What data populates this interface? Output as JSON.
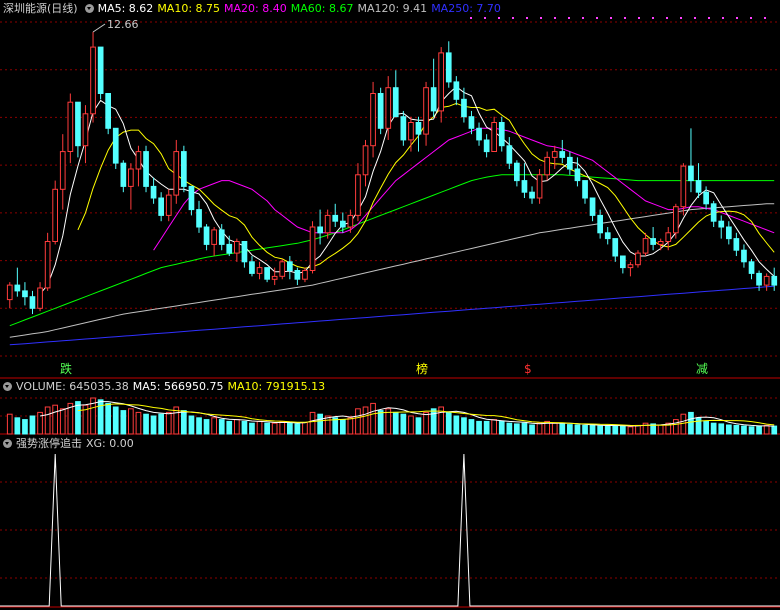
{
  "main_legend": {
    "title": "深圳能源(日线)",
    "ma5": "MA5: 8.62",
    "ma10": "MA10: 8.75",
    "ma20": "MA20: 8.40",
    "ma60": "MA60: 8.67",
    "ma120": "MA120: 9.41",
    "ma250": "MA250: 7.70"
  },
  "volume_legend": {
    "volume": "VOLUME: 645035.38",
    "ma5": "MA5: 566950.75",
    "ma10": "MA10: 791915.13"
  },
  "indicator_legend": {
    "name": "强势涨停追击",
    "xg": "XG: 0.00"
  },
  "high_label": "12.66",
  "markers": {
    "m1": "跌",
    "m2": "榜",
    "m3": "$",
    "m4": "减"
  },
  "colors": {
    "up": "#ff3c3c",
    "down": "#54ffff",
    "ma5": "#ffffff",
    "ma10": "#ffff00",
    "ma20": "#ff00ff",
    "ma60": "#00ff00",
    "ma120": "#c0c0c0",
    "ma250": "#3030ff",
    "grid": "#8b0000",
    "axis": "#c00000"
  },
  "chart_data": {
    "type": "candlestick",
    "price_range": [
      7.25,
      12.66
    ],
    "candles": [
      [
        8.05,
        8.35,
        7.9,
        8.3
      ],
      [
        8.3,
        8.6,
        8.1,
        8.2
      ],
      [
        8.2,
        8.35,
        7.95,
        8.1
      ],
      [
        8.1,
        8.2,
        7.8,
        7.9
      ],
      [
        7.9,
        8.35,
        7.85,
        8.25
      ],
      [
        8.25,
        9.2,
        8.2,
        9.05
      ],
      [
        9.05,
        10.1,
        9.0,
        9.95
      ],
      [
        9.95,
        10.9,
        9.6,
        10.6
      ],
      [
        10.6,
        11.6,
        10.4,
        11.45
      ],
      [
        11.45,
        11.4,
        10.5,
        10.7
      ],
      [
        10.7,
        11.4,
        10.4,
        11.25
      ],
      [
        11.25,
        12.66,
        11.1,
        12.4
      ],
      [
        12.4,
        12.2,
        11.5,
        11.6
      ],
      [
        11.6,
        11.4,
        10.9,
        11.0
      ],
      [
        11.0,
        10.95,
        10.3,
        10.4
      ],
      [
        10.4,
        10.45,
        9.9,
        10.0
      ],
      [
        10.0,
        10.4,
        9.6,
        10.3
      ],
      [
        10.3,
        10.7,
        10.0,
        10.6
      ],
      [
        10.6,
        10.7,
        9.9,
        10.0
      ],
      [
        10.0,
        10.15,
        9.7,
        9.8
      ],
      [
        9.8,
        9.9,
        9.4,
        9.5
      ],
      [
        9.5,
        9.95,
        9.4,
        9.85
      ],
      [
        9.85,
        10.8,
        9.7,
        10.6
      ],
      [
        10.6,
        10.7,
        9.9,
        10.0
      ],
      [
        10.0,
        9.95,
        9.5,
        9.6
      ],
      [
        9.6,
        9.75,
        9.2,
        9.3
      ],
      [
        9.3,
        9.35,
        8.9,
        9.0
      ],
      [
        9.0,
        9.3,
        8.8,
        9.25
      ],
      [
        9.25,
        9.35,
        8.9,
        9.0
      ],
      [
        9.0,
        9.15,
        8.8,
        8.85
      ],
      [
        8.85,
        9.1,
        8.7,
        9.05
      ],
      [
        9.05,
        9.0,
        8.6,
        8.7
      ],
      [
        8.7,
        8.8,
        8.45,
        8.5
      ],
      [
        8.5,
        8.7,
        8.4,
        8.6
      ],
      [
        8.6,
        8.55,
        8.35,
        8.4
      ],
      [
        8.4,
        8.6,
        8.3,
        8.45
      ],
      [
        8.45,
        8.75,
        8.4,
        8.7
      ],
      [
        8.7,
        8.8,
        8.4,
        8.55
      ],
      [
        8.55,
        8.6,
        8.3,
        8.4
      ],
      [
        8.4,
        8.6,
        8.35,
        8.55
      ],
      [
        8.55,
        9.4,
        8.5,
        9.3
      ],
      [
        9.3,
        9.6,
        9.0,
        9.2
      ],
      [
        9.2,
        9.6,
        9.1,
        9.5
      ],
      [
        9.5,
        9.7,
        9.3,
        9.4
      ],
      [
        9.4,
        9.55,
        9.2,
        9.3
      ],
      [
        9.3,
        9.6,
        9.2,
        9.5
      ],
      [
        9.5,
        10.4,
        9.4,
        10.2
      ],
      [
        10.2,
        10.8,
        10.0,
        10.7
      ],
      [
        10.7,
        11.8,
        10.5,
        11.6
      ],
      [
        11.6,
        11.7,
        10.9,
        11.0
      ],
      [
        11.0,
        11.9,
        10.8,
        11.7
      ],
      [
        11.7,
        12.0,
        11.5,
        11.2
      ],
      [
        11.2,
        11.3,
        10.7,
        10.8
      ],
      [
        10.8,
        11.2,
        10.6,
        11.1
      ],
      [
        11.1,
        11.2,
        10.6,
        10.9
      ],
      [
        10.9,
        11.8,
        10.7,
        11.7
      ],
      [
        11.7,
        12.2,
        11.2,
        11.3
      ],
      [
        11.3,
        12.4,
        11.1,
        12.3
      ],
      [
        12.3,
        12.5,
        11.7,
        11.8
      ],
      [
        11.8,
        11.9,
        11.4,
        11.5
      ],
      [
        11.5,
        11.7,
        11.1,
        11.2
      ],
      [
        11.2,
        11.3,
        10.9,
        11.0
      ],
      [
        11.0,
        11.1,
        10.7,
        10.8
      ],
      [
        10.8,
        10.9,
        10.5,
        10.6
      ],
      [
        10.6,
        11.2,
        10.6,
        11.1
      ],
      [
        11.1,
        11.2,
        10.6,
        10.7
      ],
      [
        10.7,
        10.85,
        10.3,
        10.4
      ],
      [
        10.4,
        10.45,
        10.0,
        10.1
      ],
      [
        10.1,
        10.4,
        9.8,
        9.9
      ],
      [
        9.9,
        10.0,
        9.7,
        9.8
      ],
      [
        9.8,
        10.3,
        9.7,
        10.2
      ],
      [
        10.2,
        10.6,
        10.1,
        10.5
      ],
      [
        10.5,
        10.7,
        10.3,
        10.6
      ],
      [
        10.6,
        10.8,
        10.4,
        10.5
      ],
      [
        10.5,
        10.6,
        10.2,
        10.3
      ],
      [
        10.3,
        10.5,
        10.0,
        10.1
      ],
      [
        10.1,
        10.1,
        9.7,
        9.8
      ],
      [
        9.8,
        9.8,
        9.4,
        9.5
      ],
      [
        9.5,
        9.6,
        9.1,
        9.2
      ],
      [
        9.2,
        9.3,
        9.0,
        9.1
      ],
      [
        9.1,
        9.1,
        8.7,
        8.8
      ],
      [
        8.8,
        8.8,
        8.5,
        8.6
      ],
      [
        8.6,
        8.7,
        8.45,
        8.65
      ],
      [
        8.65,
        8.9,
        8.6,
        8.85
      ],
      [
        8.85,
        9.2,
        8.8,
        9.1
      ],
      [
        9.1,
        9.3,
        8.9,
        9.0
      ],
      [
        9.0,
        9.1,
        8.9,
        9.05
      ],
      [
        9.05,
        9.3,
        8.9,
        9.2
      ],
      [
        9.2,
        9.7,
        9.1,
        9.65
      ],
      [
        9.65,
        10.4,
        9.5,
        10.35
      ],
      [
        10.35,
        11.0,
        9.9,
        10.1
      ],
      [
        10.1,
        10.4,
        9.8,
        9.9
      ],
      [
        9.9,
        10.0,
        9.6,
        9.7
      ],
      [
        9.7,
        9.75,
        9.3,
        9.4
      ],
      [
        9.4,
        9.5,
        9.1,
        9.3
      ],
      [
        9.3,
        9.4,
        9.0,
        9.1
      ],
      [
        9.1,
        9.2,
        8.8,
        8.9
      ],
      [
        8.9,
        9.0,
        8.6,
        8.7
      ],
      [
        8.7,
        8.75,
        8.4,
        8.5
      ],
      [
        8.5,
        8.55,
        8.2,
        8.3
      ],
      [
        8.3,
        8.5,
        8.2,
        8.45
      ],
      [
        8.45,
        8.6,
        8.2,
        8.3
      ]
    ],
    "volume_ratio": [
      0.55,
      0.45,
      0.4,
      0.5,
      0.6,
      0.75,
      0.8,
      0.7,
      0.85,
      0.9,
      0.8,
      1.0,
      0.95,
      0.85,
      0.75,
      0.65,
      0.7,
      0.6,
      0.55,
      0.5,
      0.55,
      0.6,
      0.75,
      0.65,
      0.5,
      0.45,
      0.4,
      0.45,
      0.4,
      0.35,
      0.4,
      0.35,
      0.3,
      0.35,
      0.3,
      0.3,
      0.35,
      0.3,
      0.28,
      0.32,
      0.6,
      0.55,
      0.5,
      0.45,
      0.4,
      0.45,
      0.7,
      0.75,
      0.85,
      0.65,
      0.7,
      0.6,
      0.55,
      0.5,
      0.45,
      0.6,
      0.7,
      0.75,
      0.6,
      0.5,
      0.45,
      0.4,
      0.35,
      0.35,
      0.4,
      0.35,
      0.3,
      0.28,
      0.3,
      0.25,
      0.3,
      0.35,
      0.3,
      0.28,
      0.26,
      0.25,
      0.24,
      0.25,
      0.22,
      0.22,
      0.25,
      0.22,
      0.2,
      0.24,
      0.3,
      0.28,
      0.25,
      0.3,
      0.4,
      0.55,
      0.6,
      0.45,
      0.35,
      0.3,
      0.28,
      0.25,
      0.24,
      0.22,
      0.2,
      0.22,
      0.24,
      0.22
    ],
    "signal_spikes": [
      6,
      60
    ],
    "ma_sets": {
      "ma20": [
        null,
        null,
        null,
        null,
        null,
        null,
        null,
        null,
        null,
        null,
        null,
        null,
        null,
        null,
        null,
        null,
        null,
        null,
        null,
        8.9,
        9.1,
        9.3,
        9.5,
        9.7,
        9.85,
        9.95,
        10.0,
        10.05,
        10.1,
        10.1,
        10.05,
        10.0,
        9.95,
        9.85,
        9.75,
        9.6,
        9.5,
        9.4,
        9.3,
        9.25,
        9.2,
        9.2,
        9.2,
        9.2,
        9.2,
        9.25,
        9.35,
        9.5,
        9.65,
        9.8,
        9.95,
        10.1,
        10.2,
        10.3,
        10.4,
        10.5,
        10.6,
        10.7,
        10.8,
        10.85,
        10.9,
        10.95,
        11.0,
        11.0,
        11.0,
        10.98,
        10.95,
        10.9,
        10.85,
        10.8,
        10.75,
        10.7,
        10.68,
        10.65,
        10.6,
        10.55,
        10.5,
        10.45,
        10.35,
        10.25,
        10.15,
        10.05,
        9.95,
        9.85,
        9.75,
        9.7,
        9.65,
        9.6,
        9.6,
        9.62,
        9.65,
        9.65,
        9.62,
        9.6,
        9.55,
        9.5,
        9.45,
        9.4,
        9.35,
        9.3,
        9.25,
        9.2
      ],
      "ma60": [
        7.6,
        7.65,
        7.7,
        7.75,
        7.8,
        7.85,
        7.9,
        7.95,
        8.0,
        8.05,
        8.1,
        8.15,
        8.2,
        8.25,
        8.3,
        8.35,
        8.4,
        8.45,
        8.5,
        8.55,
        8.6,
        8.63,
        8.66,
        8.69,
        8.72,
        8.75,
        8.78,
        8.8,
        8.82,
        8.84,
        8.86,
        8.88,
        8.9,
        8.92,
        8.94,
        8.96,
        8.98,
        9.0,
        9.02,
        9.05,
        9.08,
        9.12,
        9.16,
        9.2,
        9.25,
        9.3,
        9.35,
        9.4,
        9.45,
        9.5,
        9.55,
        9.6,
        9.65,
        9.7,
        9.75,
        9.8,
        9.85,
        9.9,
        9.95,
        10.0,
        10.05,
        10.1,
        10.13,
        10.16,
        10.18,
        10.2,
        10.2,
        10.2,
        10.2,
        10.2,
        10.2,
        10.2,
        10.2,
        10.2,
        10.19,
        10.18,
        10.17,
        10.16,
        10.15,
        10.14,
        10.13,
        10.12,
        10.11,
        10.1,
        10.1,
        10.1,
        10.1,
        10.1,
        10.1,
        10.1,
        10.1,
        10.1,
        10.1,
        10.1,
        10.1,
        10.1,
        10.1,
        10.1,
        10.1,
        10.1,
        10.1,
        10.1
      ],
      "ma120": [
        7.4,
        7.42,
        7.44,
        7.46,
        7.48,
        7.5,
        7.53,
        7.56,
        7.59,
        7.62,
        7.65,
        7.68,
        7.71,
        7.74,
        7.77,
        7.8,
        7.82,
        7.84,
        7.86,
        7.88,
        7.9,
        7.92,
        7.94,
        7.96,
        7.98,
        8.0,
        8.02,
        8.04,
        8.06,
        8.08,
        8.1,
        8.12,
        8.14,
        8.16,
        8.18,
        8.2,
        8.22,
        8.24,
        8.26,
        8.28,
        8.3,
        8.33,
        8.36,
        8.39,
        8.42,
        8.45,
        8.48,
        8.51,
        8.54,
        8.57,
        8.6,
        8.63,
        8.66,
        8.69,
        8.72,
        8.75,
        8.78,
        8.81,
        8.84,
        8.87,
        8.9,
        8.93,
        8.96,
        8.99,
        9.02,
        9.05,
        9.08,
        9.11,
        9.14,
        9.17,
        9.2,
        9.22,
        9.24,
        9.26,
        9.28,
        9.3,
        9.32,
        9.34,
        9.36,
        9.38,
        9.4,
        9.42,
        9.44,
        9.46,
        9.48,
        9.5,
        9.52,
        9.54,
        9.56,
        9.58,
        9.6,
        9.61,
        9.62,
        9.63,
        9.64,
        9.65,
        9.66,
        9.67,
        9.68,
        9.69,
        9.7,
        9.7
      ],
      "ma250": [
        7.27,
        7.28,
        7.29,
        7.3,
        7.31,
        7.32,
        7.33,
        7.34,
        7.35,
        7.36,
        7.37,
        7.38,
        7.39,
        7.4,
        7.41,
        7.42,
        7.43,
        7.44,
        7.45,
        7.46,
        7.47,
        7.48,
        7.49,
        7.5,
        7.51,
        7.52,
        7.53,
        7.54,
        7.55,
        7.56,
        7.57,
        7.58,
        7.59,
        7.6,
        7.61,
        7.62,
        7.63,
        7.64,
        7.65,
        7.66,
        7.67,
        7.68,
        7.69,
        7.7,
        7.71,
        7.72,
        7.73,
        7.74,
        7.75,
        7.76,
        7.77,
        7.78,
        7.79,
        7.8,
        7.81,
        7.82,
        7.83,
        7.84,
        7.85,
        7.86,
        7.87,
        7.88,
        7.89,
        7.9,
        7.91,
        7.92,
        7.93,
        7.94,
        7.95,
        7.96,
        7.97,
        7.98,
        7.99,
        8.0,
        8.01,
        8.02,
        8.03,
        8.04,
        8.05,
        8.06,
        8.07,
        8.08,
        8.09,
        8.1,
        8.11,
        8.12,
        8.13,
        8.14,
        8.15,
        8.16,
        8.17,
        8.18,
        8.19,
        8.2,
        8.21,
        8.22,
        8.23,
        8.24,
        8.25,
        8.26,
        8.27,
        8.28
      ]
    }
  }
}
